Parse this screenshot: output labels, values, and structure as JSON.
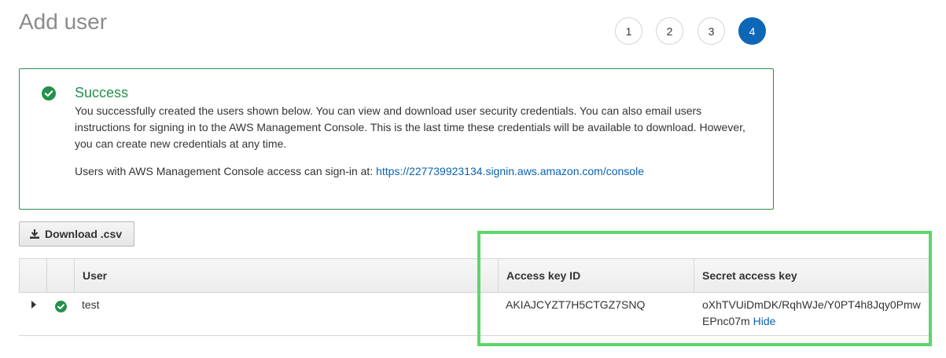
{
  "page": {
    "title": "Add user"
  },
  "steps": [
    {
      "label": "1",
      "active": false
    },
    {
      "label": "2",
      "active": false
    },
    {
      "label": "3",
      "active": false
    },
    {
      "label": "4",
      "active": true
    }
  ],
  "success": {
    "title": "Success",
    "message": "You successfully created the users shown below. You can view and download user security credentials. You can also email users instructions for signing in to the AWS Management Console. This is the last time these credentials will be available to download. However, you can create new credentials at any time.",
    "signin_prefix": "Users with AWS Management Console access can sign-in at: ",
    "signin_url": "https://227739923134.signin.aws.amazon.com/console"
  },
  "toolbar": {
    "download_label": "Download .csv"
  },
  "table": {
    "headers": {
      "user": "User",
      "access_key_id": "Access key ID",
      "secret_access_key": "Secret access key"
    },
    "rows": [
      {
        "user": "test",
        "access_key_id": "AKIAJCYZT7H5CTGZ7SNQ",
        "secret_access_key": "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",
        "hide_label": "Hide"
      }
    ]
  },
  "colors": {
    "success_green": "#23914a",
    "step_active": "#0d66b6",
    "link_blue": "#0b62b0",
    "highlight_green": "#5cd66a"
  },
  "icons": {
    "success": "check-circle-icon",
    "download": "download-icon",
    "expand": "caret-right-icon"
  }
}
